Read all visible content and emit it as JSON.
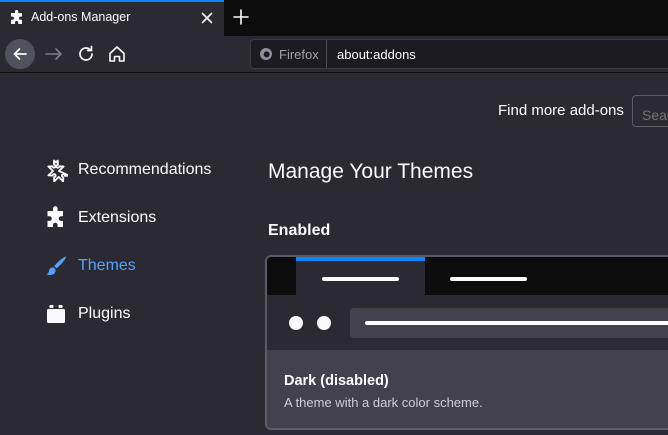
{
  "browser": {
    "tab": {
      "title": "Add-ons Manager",
      "icon": "puzzle-icon"
    },
    "new_tab_label": "+",
    "urlbar": {
      "identity_label": "Firefox",
      "url": "about:addons"
    }
  },
  "header": {
    "find_more_label": "Find more add-ons",
    "search_placeholder": "Search addons.mozilla.org"
  },
  "sidebar": {
    "items": [
      {
        "label": "Recommendations",
        "icon": "sparkle-puzzle-icon",
        "selected": false
      },
      {
        "label": "Extensions",
        "icon": "puzzle-icon",
        "selected": false
      },
      {
        "label": "Themes",
        "icon": "brush-icon",
        "selected": true
      },
      {
        "label": "Plugins",
        "icon": "plugin-icon",
        "selected": false
      }
    ]
  },
  "main": {
    "title": "Manage Your Themes",
    "sections": [
      {
        "heading": "Enabled",
        "cards": [
          {
            "name": "Dark (disabled)",
            "description": "A theme with a dark color scheme."
          }
        ]
      }
    ]
  },
  "colors": {
    "accent": "#0a84ff",
    "selected_text": "#54a3ff",
    "background": "#2b2a33",
    "tabstrip": "#0c0c0d"
  }
}
